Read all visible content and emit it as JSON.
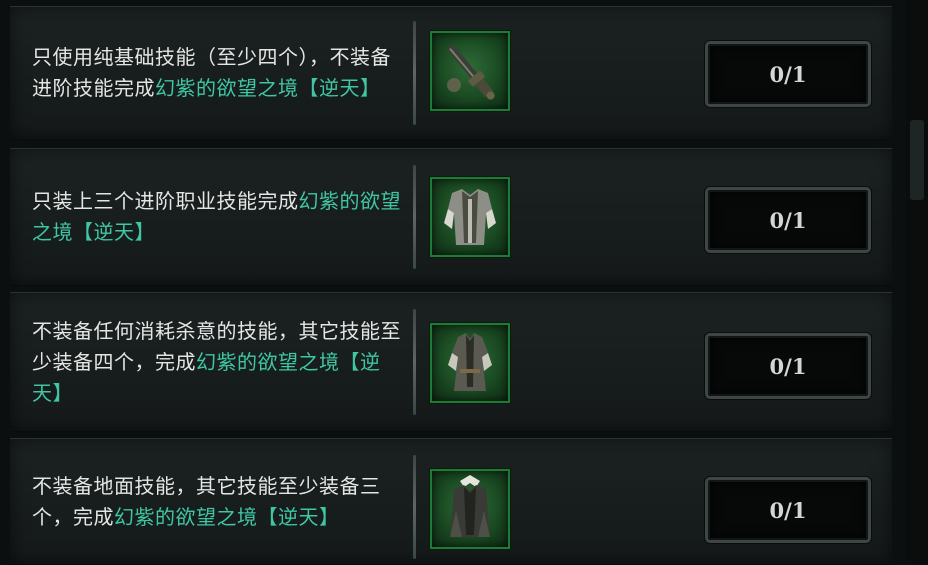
{
  "quests": [
    {
      "text_plain": "只使用纯基础技能（至少四个），不装备进阶技能完成",
      "text_highlight": "幻紫的欲望之境【逆天】",
      "icon": "weapon-icon",
      "progress": "0/1"
    },
    {
      "text_plain": "只装上三个进阶职业技能完成",
      "text_highlight": "幻紫的欲望之境【逆天】",
      "icon": "armor-icon",
      "progress": "0/1"
    },
    {
      "text_plain": "不装备任何消耗杀意的技能，其它技能至少装备四个，完成",
      "text_highlight": "幻紫的欲望之境【逆天】",
      "icon": "robe-icon",
      "progress": "0/1"
    },
    {
      "text_plain": "不装备地面技能，其它技能至少装备三个，完成",
      "text_highlight": "幻紫的欲望之境【逆天】",
      "icon": "cloak-icon",
      "progress": "0/1"
    }
  ],
  "colors": {
    "highlight": "#3fc6a4",
    "text": "#e4e6e4",
    "icon_border": "#1e7a35"
  }
}
